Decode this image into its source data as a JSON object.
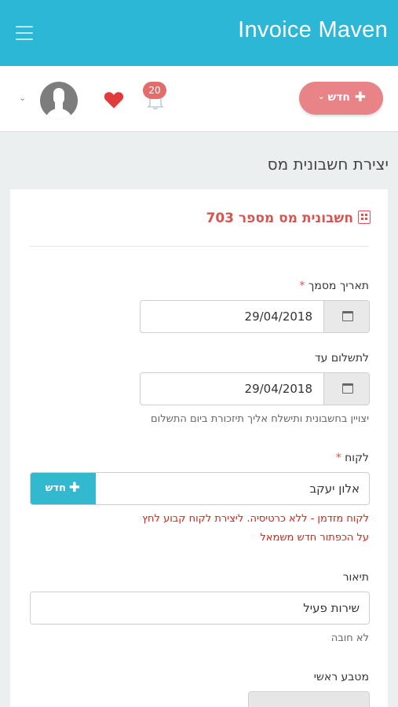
{
  "app": {
    "title": "Invoice Maven"
  },
  "toolbar": {
    "new_button_label": "חדש",
    "notifications_count": "20",
    "colors": {
      "topbar": "#2db7d7",
      "new_button": "#e88387",
      "heart": "#e23b3b"
    }
  },
  "page": {
    "title": "יצירת חשבונית מס"
  },
  "form": {
    "heading": "חשבונית מס מספר 703",
    "doc_date": {
      "label": "תאריך מסמך",
      "value": "29/04/2018",
      "required": "*"
    },
    "due_date": {
      "label": "לתשלום עד",
      "value": "29/04/2018",
      "help": "יצויין בחשבונית ותישלח אליך תיזכורת ביום התשלום"
    },
    "client": {
      "label": "לקוח",
      "required": "*",
      "value": "אלון יעקב",
      "new_button_label": "חדש",
      "warning_line1": "לקוח מזדמן - ללא כרטיסיה. ליצירת לקוח קבוע לחץ",
      "warning_line2": "על הכפתור חדש משמאל"
    },
    "description": {
      "label": "תיאור",
      "value": "שירות פעיל",
      "help": "לא חובה"
    },
    "currency": {
      "label": "מטבע ראשי"
    }
  }
}
